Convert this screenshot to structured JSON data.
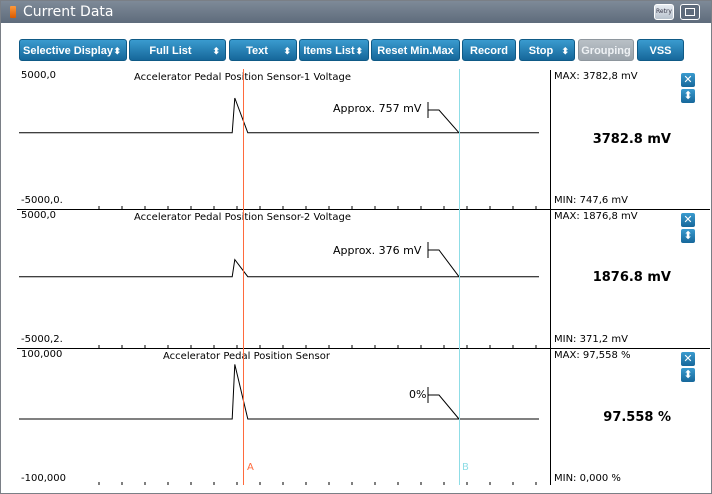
{
  "window": {
    "title": "Current Data",
    "retry_label": "Retry",
    "title_icon": "sensor-icon",
    "restore_icon": "restore-window-icon"
  },
  "toolbar": {
    "selective_display": "Selective Display",
    "full_list": "Full List",
    "text": "Text",
    "items_list": "Items List",
    "reset_minmax": "Reset Min.Max",
    "record": "Record",
    "stop": "Stop",
    "grouping": "Grouping",
    "vss": "VSS",
    "spinner_glyph": "⬍"
  },
  "colors": {
    "toolbar_button": "#1f7fb3",
    "cursor_a": "#ff6a3d",
    "cursor_b": "#8fdde6",
    "title_bar": "#6f7c8c"
  },
  "cursors": {
    "a_label": "A",
    "b_label": "B"
  },
  "panel_buttons": {
    "close_icon": "close-icon",
    "expand_icon": "expand-icon",
    "close_glyph": "✕",
    "expand_glyph": "⬍"
  },
  "panels": [
    {
      "name": "Accelerator Pedal Position Sensor-1 Voltage",
      "y_max_label": "5000,0",
      "y_min_label": "-5000,0.",
      "max": "MAX: 3782,8 mV",
      "min": "MIN: 747,6 mV",
      "current": "3782.8 mV",
      "annotation": "Approx. 757 mV",
      "y_range": [
        -5000,
        5000
      ],
      "signal": [
        [
          0,
          757
        ],
        [
          0.41,
          757
        ],
        [
          0.415,
          3782.8
        ],
        [
          0.44,
          757
        ],
        [
          1,
          757
        ]
      ]
    },
    {
      "name": "Accelerator Pedal Position Sensor-2 Voltage",
      "y_max_label": "5000,0",
      "y_min_label": "-5000,2.",
      "max": "MAX: 1876,8 mV",
      "min": "MIN: 371,2 mV",
      "current": "1876.8 mV",
      "annotation": "Approx. 376 mV",
      "y_range": [
        -5000,
        5000
      ],
      "signal": [
        [
          0,
          376
        ],
        [
          0.41,
          376
        ],
        [
          0.415,
          1876.8
        ],
        [
          0.44,
          376
        ],
        [
          1,
          376
        ]
      ]
    },
    {
      "name": "Accelerator Pedal Position Sensor",
      "y_max_label": "100,000",
      "y_min_label": "-100,000",
      "max": "MAX: 97,558 %",
      "min": "MIN: 0,000 %",
      "current": "97.558 %",
      "annotation": "0%",
      "y_range": [
        -100,
        100
      ],
      "signal": [
        [
          0,
          0
        ],
        [
          0.41,
          0
        ],
        [
          0.415,
          97.558
        ],
        [
          0.44,
          0
        ],
        [
          1,
          0
        ]
      ]
    }
  ]
}
